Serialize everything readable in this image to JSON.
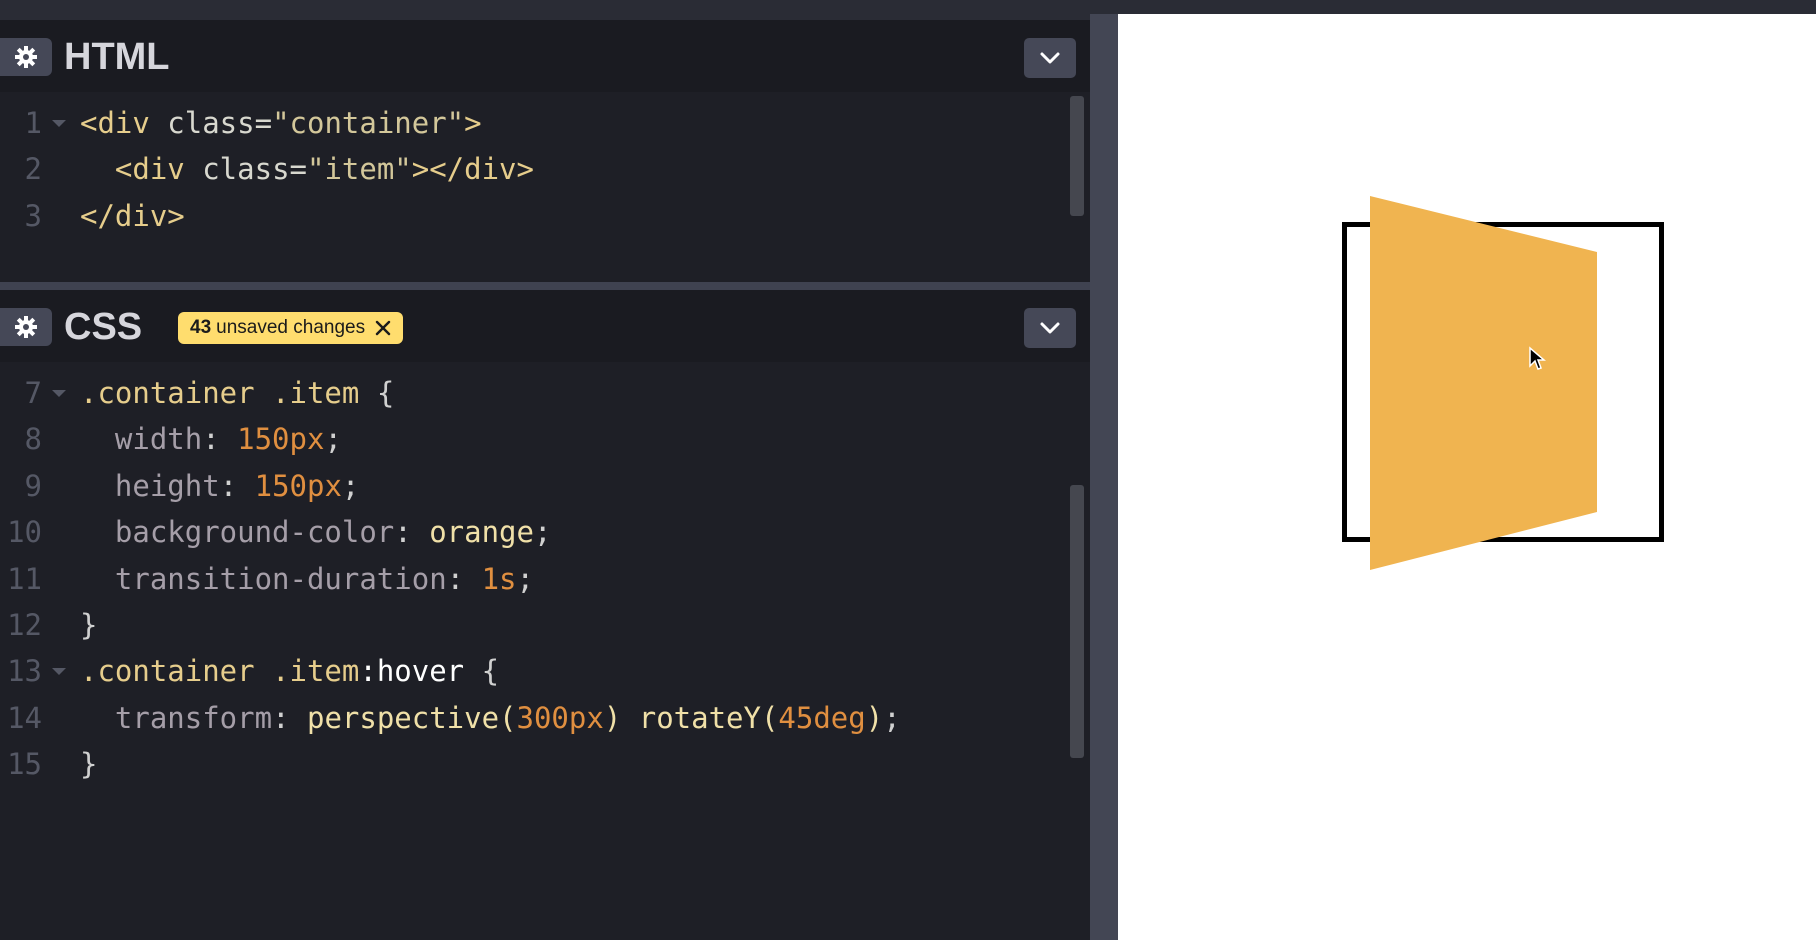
{
  "html_pane": {
    "title": "HTML",
    "lines": [
      {
        "num": "1",
        "tokens": [
          [
            "tag",
            "<div"
          ],
          [
            "attr",
            " class="
          ],
          [
            "str",
            "\"container\""
          ],
          [
            "tag",
            ">"
          ]
        ]
      },
      {
        "num": "2",
        "tokens": [
          [
            "tag",
            "  <div"
          ],
          [
            "attr",
            " class="
          ],
          [
            "str",
            "\"item\""
          ],
          [
            "tag",
            "></div>"
          ]
        ]
      },
      {
        "num": "3",
        "tokens": [
          [
            "tag",
            "</div>"
          ]
        ]
      }
    ]
  },
  "css_pane": {
    "title": "CSS",
    "unsaved_badge": {
      "count": "43",
      "label": "unsaved changes"
    },
    "lines": [
      {
        "num": "7",
        "tokens": [
          [
            "sel",
            ".container .item"
          ],
          [
            "punc",
            " {"
          ]
        ]
      },
      {
        "num": "8",
        "tokens": [
          [
            "prop",
            "  width"
          ],
          [
            "punc",
            ": "
          ],
          [
            "num",
            "150px"
          ],
          [
            "punc",
            ";"
          ]
        ]
      },
      {
        "num": "9",
        "tokens": [
          [
            "prop",
            "  height"
          ],
          [
            "punc",
            ": "
          ],
          [
            "num",
            "150px"
          ],
          [
            "punc",
            ";"
          ]
        ]
      },
      {
        "num": "10",
        "tokens": [
          [
            "prop",
            "  background-color"
          ],
          [
            "punc",
            ": "
          ],
          [
            "val",
            "orange"
          ],
          [
            "punc",
            ";"
          ]
        ]
      },
      {
        "num": "11",
        "tokens": [
          [
            "prop",
            "  transition-duration"
          ],
          [
            "punc",
            ": "
          ],
          [
            "num",
            "1s"
          ],
          [
            "punc",
            ";"
          ]
        ]
      },
      {
        "num": "12",
        "tokens": [
          [
            "punc",
            "}"
          ]
        ]
      },
      {
        "num": "13",
        "tokens": [
          [
            "sel",
            ".container .item"
          ],
          [
            "pseudo",
            ":hover"
          ],
          [
            "punc",
            " {"
          ]
        ]
      },
      {
        "num": "14",
        "tokens": [
          [
            "prop",
            "  transform"
          ],
          [
            "punc",
            ": "
          ],
          [
            "val",
            "perspective("
          ],
          [
            "num",
            "300px"
          ],
          [
            "val",
            ") rotateY("
          ],
          [
            "num",
            "45deg"
          ],
          [
            "val",
            ")"
          ],
          [
            "punc",
            ";"
          ]
        ]
      },
      {
        "num": "15",
        "tokens": [
          [
            "punc",
            "}"
          ]
        ]
      }
    ]
  },
  "icons": {
    "settings": "gear-icon",
    "collapse": "chevron-down-icon",
    "dismiss": "close-icon",
    "pointer": "mouse-cursor-icon"
  },
  "colors": {
    "item_fill": "#f0b450",
    "badge_bg": "#ffdd6e",
    "editor_bg": "#1e1f26",
    "preview_bg": "#ffffff"
  },
  "preview": {
    "hover_transform": "perspective(300px) rotateY(45deg)"
  }
}
